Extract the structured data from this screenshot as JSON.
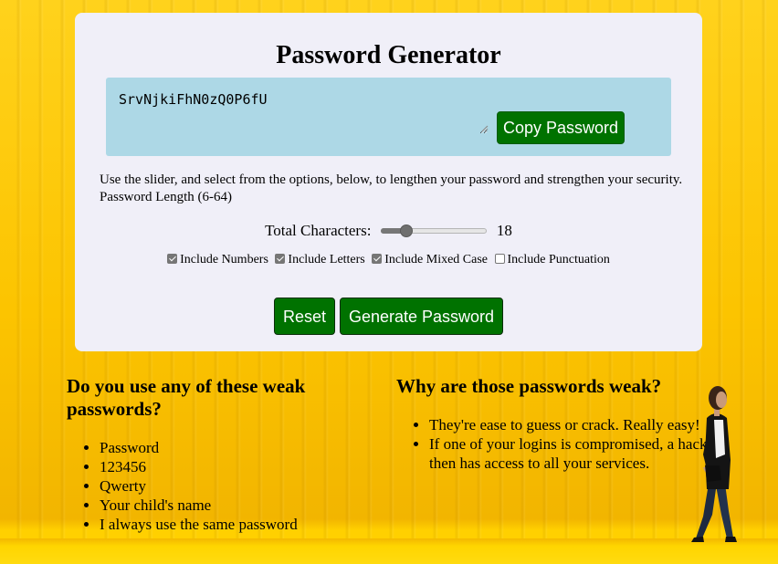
{
  "generator": {
    "title": "Password Generator",
    "password_value": "SrvNjkiFhN0zQ0P6fU",
    "copy_button_label": "Copy Password",
    "description": "Use the slider, and select from the options, below, to lengthen your password and strengthen your security. Password Length (6-64)",
    "length": {
      "label": "Total Characters:",
      "value": "18",
      "min": 6,
      "max": 64,
      "current": 18
    },
    "options": [
      {
        "label": "Include Numbers",
        "checked": true
      },
      {
        "label": "Include Letters",
        "checked": true
      },
      {
        "label": "Include Mixed Case",
        "checked": true
      },
      {
        "label": "Include Punctuation",
        "checked": false
      }
    ],
    "reset_button_label": "Reset",
    "generate_button_label": "Generate Password"
  },
  "weak_passwords": {
    "heading": "Do you use any of these weak passwords?",
    "items": [
      "Password",
      "123456",
      "Qwerty",
      "Your child's name",
      "I always use the same password"
    ]
  },
  "why_weak": {
    "heading": "Why are those passwords weak?",
    "items": [
      "They're ease to guess or crack. Really easy!",
      "If one of your logins is compromised, a hacker then has access to all your services."
    ]
  },
  "colors": {
    "background": "#fcc400",
    "card": "#f0eff8",
    "password_panel": "#add8e6",
    "button": "#007200",
    "button_text": "#ffffff"
  },
  "icons": {
    "checkbox_checked": "checkmark",
    "textarea_resize": "resize-grip-icon"
  }
}
